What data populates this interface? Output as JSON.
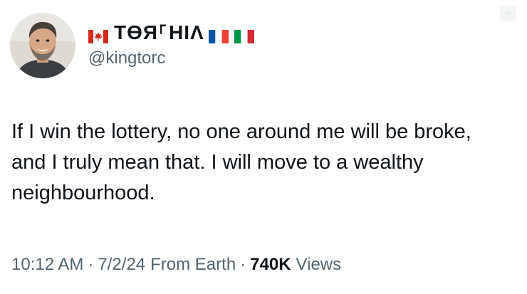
{
  "author": {
    "display_name": "TӨЯ⸀HIΛ",
    "handle": "@kingtorc",
    "flags": [
      "canada-flag",
      "france-flag",
      "italy-flag"
    ]
  },
  "more_button": {
    "label": "…",
    "icon": "more-icon"
  },
  "tweet": {
    "text": "If I win the lottery, no one around me will be broke, and I truly mean that. I will move to a wealthy neighbourhood."
  },
  "meta": {
    "time": "10:12 AM",
    "separator": "·",
    "date": "7/2/24",
    "source": "From Earth",
    "views_count": "740K",
    "views_label": "Views"
  },
  "colors": {
    "text_primary": "#0f1419",
    "text_secondary": "#536471",
    "canada_red": "#d52b1e",
    "france_blue": "#0055a4",
    "italy_green": "#009246"
  }
}
